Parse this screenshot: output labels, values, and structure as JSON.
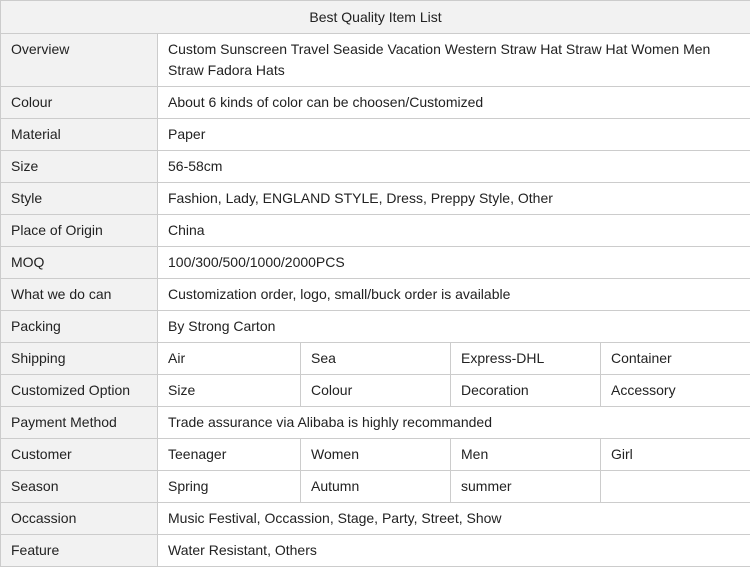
{
  "table": {
    "title": "Best Quality Item List",
    "rows": [
      {
        "label": "Overview",
        "cells": [
          "Custom Sunscreen Travel Seaside Vacation Western Straw Hat Straw Hat Women Men Straw Fadora Hats"
        ]
      },
      {
        "label": "Colour",
        "cells": [
          "About 6 kinds of color can be choosen/Customized"
        ]
      },
      {
        "label": "Material",
        "cells": [
          "Paper"
        ]
      },
      {
        "label": "Size",
        "cells": [
          "56-58cm"
        ]
      },
      {
        "label": "Style",
        "cells": [
          "Fashion, Lady, ENGLAND STYLE, Dress, Preppy Style, Other"
        ]
      },
      {
        "label": "Place of Origin",
        "cells": [
          "China"
        ]
      },
      {
        "label": "MOQ",
        "cells": [
          "100/300/500/1000/2000PCS"
        ]
      },
      {
        "label": "What we do can",
        "cells": [
          "Customization order, logo, small/buck order is available"
        ]
      },
      {
        "label": "Packing",
        "cells": [
          "By Strong Carton"
        ]
      },
      {
        "label": "Shipping",
        "cells": [
          "Air",
          "Sea",
          "Express-DHL",
          "Container"
        ]
      },
      {
        "label": "Customized Option",
        "cells": [
          "Size",
          "Colour",
          "Decoration",
          "Accessory"
        ]
      },
      {
        "label": "Payment Method",
        "cells": [
          "Trade assurance via Alibaba is highly recommanded"
        ]
      },
      {
        "label": "Customer",
        "cells": [
          "Teenager",
          "Women",
          "Men",
          "Girl"
        ]
      },
      {
        "label": "Season",
        "cells": [
          "Spring",
          "Autumn",
          "summer",
          ""
        ]
      },
      {
        "label": "Occassion",
        "cells": [
          "Music Festival, Occassion, Stage, Party, Street, Show"
        ]
      },
      {
        "label": "Feature",
        "cells": [
          "Water Resistant, Others"
        ]
      }
    ]
  }
}
